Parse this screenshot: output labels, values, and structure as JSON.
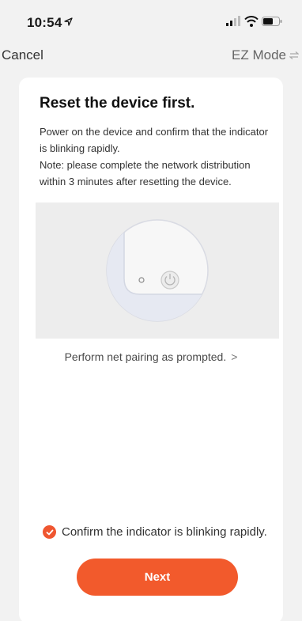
{
  "status_bar": {
    "time": "10:54",
    "location_icon": "location-arrow-icon",
    "signal_icon": "cellular-signal-icon",
    "wifi_icon": "wifi-icon",
    "battery_icon": "battery-icon"
  },
  "nav": {
    "cancel_label": "Cancel",
    "mode_label": "EZ Mode",
    "mode_icon": "swap-arrows-icon"
  },
  "content": {
    "title": "Reset the device first.",
    "description_line1": "Power on the device and confirm that the indicator is blinking rapidly.",
    "description_line2": "Note: please complete the network distribution within 3 minutes after resetting the device.",
    "pairing_link": "Perform net pairing as prompted.",
    "pairing_link_arrow": ">",
    "confirm_label": "Confirm the indicator is blinking rapidly.",
    "confirm_checked": true,
    "next_label": "Next"
  },
  "colors": {
    "accent": "#f25a2c",
    "background": "#f2f2f2",
    "card": "#ffffff"
  }
}
